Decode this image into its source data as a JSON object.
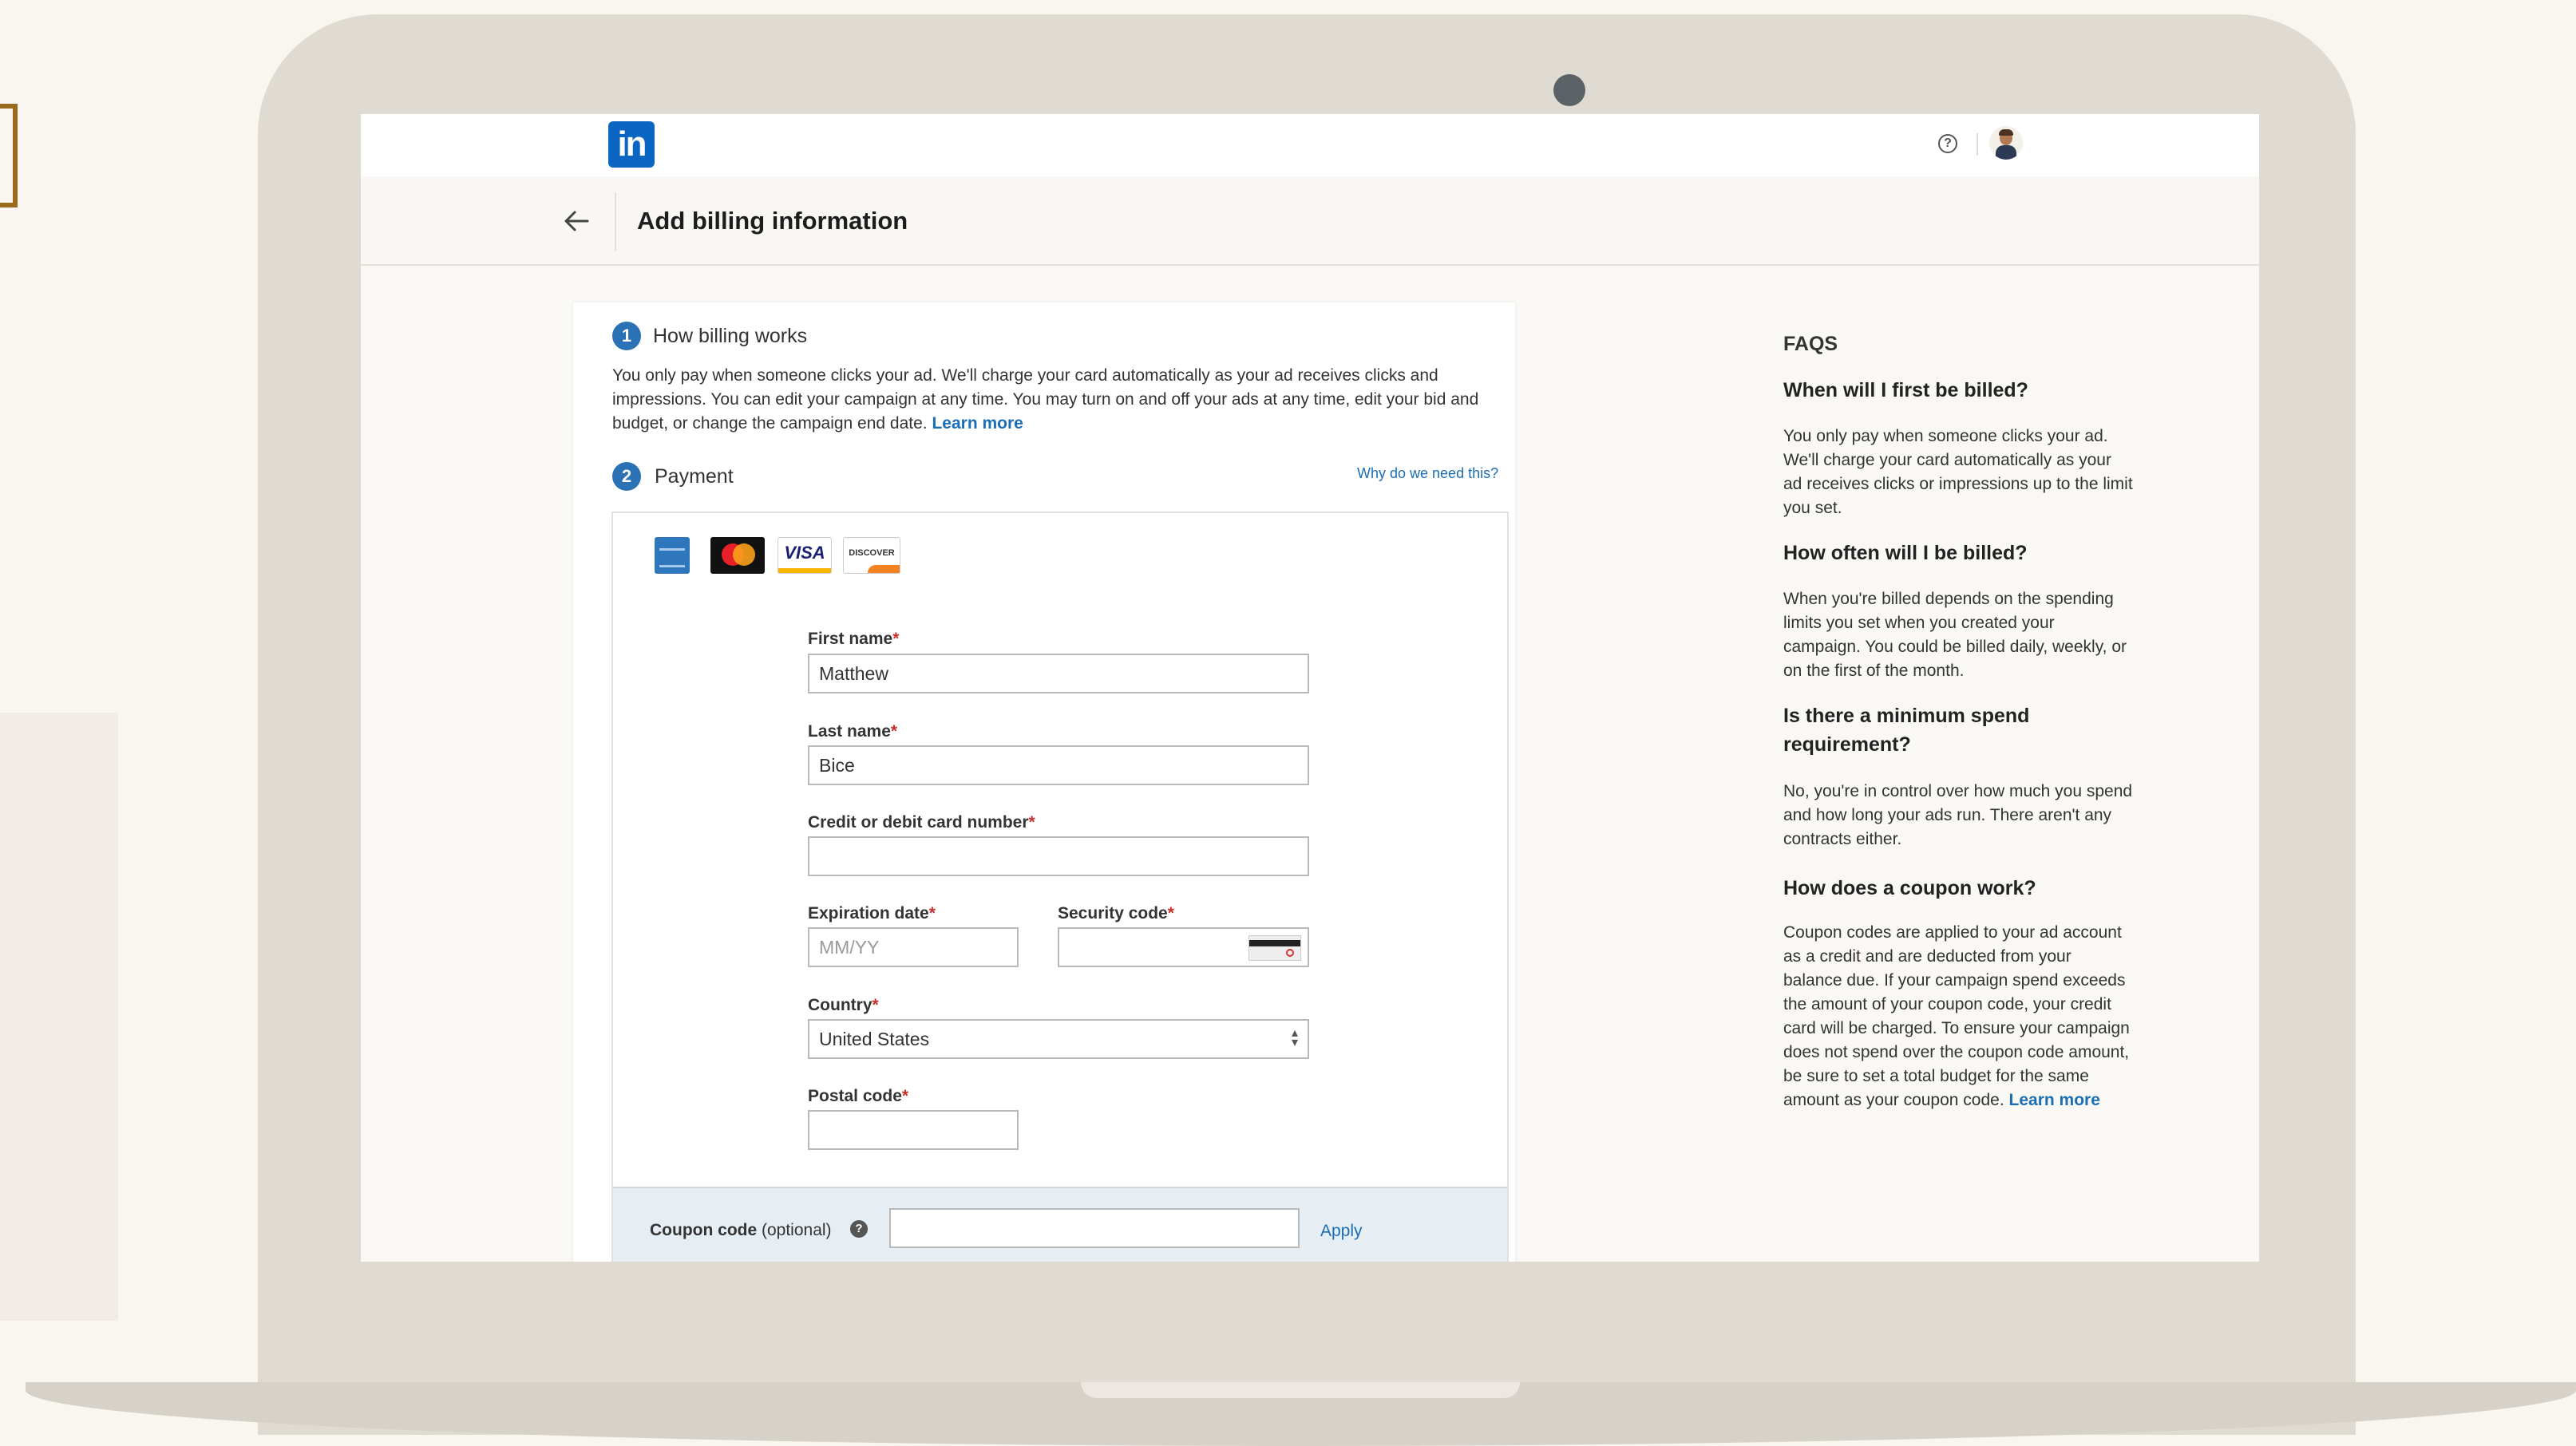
{
  "header": {
    "logo_text": "in",
    "help_symbol": "?"
  },
  "subheader": {
    "title": "Add billing information"
  },
  "billing": {
    "step_number": "1",
    "title": "How billing works",
    "description": "You only pay when someone clicks your ad. We'll charge your card automatically as your ad receives clicks and impressions. You can edit your campaign at any time. You may turn on and off your ads at any time, edit your bid and budget, or change the campaign end date.",
    "learn_more": "Learn more"
  },
  "payment": {
    "step_number": "2",
    "title": "Payment",
    "why_link": "Why do we need this?",
    "card_brands": [
      "amex-icon",
      "mastercard-icon",
      "visa-icon",
      "discover-icon"
    ],
    "visa_text": "VISA",
    "discover_text": "DISCOVER"
  },
  "form": {
    "first_name": {
      "label": "First name",
      "value": "Matthew"
    },
    "last_name": {
      "label": "Last name",
      "value": "Bice"
    },
    "card_number": {
      "label": "Credit or debit card number",
      "value": ""
    },
    "expiration": {
      "label": "Expiration date",
      "placeholder": "MM/YY"
    },
    "security_code": {
      "label": "Security code",
      "value": ""
    },
    "country": {
      "label": "Country",
      "value": "United States"
    },
    "postal_code": {
      "label": "Postal code",
      "value": ""
    },
    "required_mark": "*"
  },
  "coupon": {
    "label": "Coupon code",
    "optional": "(optional)",
    "help_symbol": "?",
    "apply": "Apply",
    "value": ""
  },
  "faqs": {
    "heading": "FAQS",
    "items": [
      {
        "question": "When will I first be billed?",
        "answer": "You only pay when someone clicks your ad. We'll charge your card automatically as your ad receives clicks or impressions up to the limit you set."
      },
      {
        "question": "How often will I be billed?",
        "answer": "When you're billed depends on the spending limits you set when you created your campaign. You could be billed daily, weekly, or on the first of the month."
      },
      {
        "question": "Is there a minimum spend requirement?",
        "answer": "No, you're in control over how much you spend and how long your ads run. There aren't any contracts either."
      },
      {
        "question": "How does a coupon work?",
        "answer": "Coupon codes are applied to your ad account as a credit and are deducted from your balance due. If your campaign spend exceeds the amount of your coupon code, your credit card will be charged. To ensure your campaign does not spend over the coupon code amount, be sure to set a total budget for the same amount as your coupon code.",
        "learn_more": "Learn more"
      }
    ]
  },
  "colors": {
    "brand": "#0a66c2",
    "link": "#1a6eb5",
    "required": "#c9302c",
    "coupon_bg": "#e6edf3",
    "laptop_frame": "#e0dbd2"
  }
}
